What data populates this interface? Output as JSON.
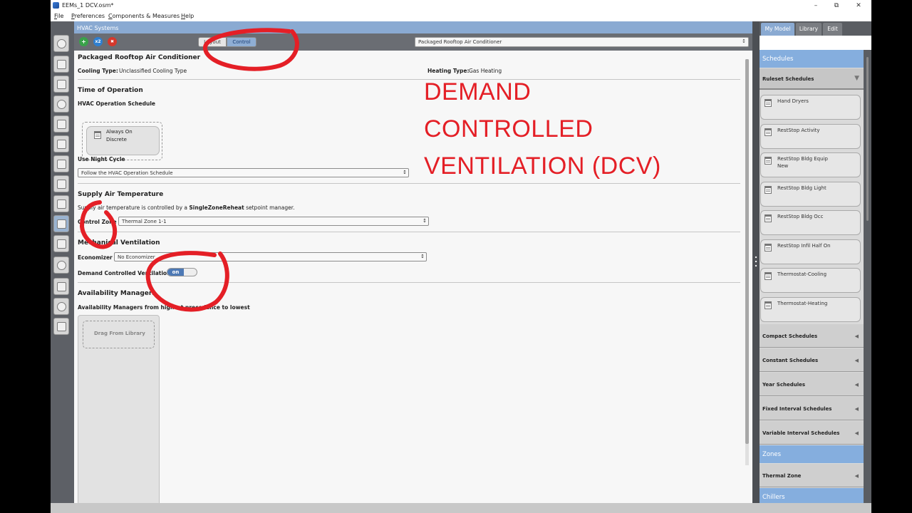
{
  "window": {
    "title": "EEMs_1 DCV.osm*",
    "minimize": "–",
    "maximize": "⧉",
    "close": "✕"
  },
  "menu": [
    "File",
    "Preferences",
    "Components & Measures",
    "Help"
  ],
  "left_nav": [
    "site-icon",
    "schedules-icon",
    "constructions-icon",
    "loads-icon",
    "space-types-icon",
    "geometry-icon",
    "facility-icon",
    "spaces-icon",
    "thermal-zones-icon",
    "hvac-systems-icon",
    "output-variables-icon",
    "simulation-settings-icon",
    "measures-icon",
    "run-icon",
    "results-icon"
  ],
  "hvac": {
    "header": "HVAC Systems",
    "toolbar": {
      "add": "+",
      "copy": "x2",
      "delete": "✖",
      "layout_tab": "Layout",
      "control_tab": "Control",
      "system_selected": "Packaged Rooftop Air Conditioner"
    },
    "system_title": "Packaged Rooftop Air Conditioner",
    "cooling_type_label": "Cooling Type:",
    "cooling_type_value": "Unclassified Cooling Type",
    "heating_type_label": "Heating Type:",
    "heating_type_value": "Gas Heating",
    "time_of_operation": {
      "title": "Time of Operation",
      "schedule_label": "HVAC Operation Schedule",
      "schedule_name_line1": "Always On",
      "schedule_name_line2": "Discrete",
      "night_cycle_label": "Use Night Cycle",
      "night_cycle_value": "Follow the HVAC Operation Schedule"
    },
    "supply_air": {
      "title": "Supply Air Temperature",
      "desc_prefix": "Supply air temperature is controlled by a",
      "desc_bold": "SingleZoneReheat",
      "desc_suffix": "setpoint manager.",
      "control_zone_label": "Control Zone",
      "control_zone_value": "Thermal Zone 1-1"
    },
    "mech_vent": {
      "title": "Mechanical Ventilation",
      "economizer_label": "Economizer",
      "economizer_value": "No Economizer",
      "dcv_label": "Demand Controlled Ventilation",
      "dcv_state": "on"
    },
    "availability": {
      "title": "Availability Managers",
      "desc": "Availability Managers from highest precedence to lowest",
      "drop_label": "Drag From Library"
    }
  },
  "overlay": {
    "line1": "DEMAND",
    "line2": "CONTROLLED",
    "line3": "VENTILATION (DCV)",
    "color": "#e41f26"
  },
  "right_panel": {
    "tabs": [
      "My Model",
      "Library",
      "Edit"
    ],
    "schedules_header": "Schedules",
    "ruleset_header": "Ruleset Schedules",
    "ruleset_items": [
      {
        "line1": "Hand Dryers",
        "line2": ""
      },
      {
        "line1": "RestStop Activity",
        "line2": ""
      },
      {
        "line1": "RestStop Bldg Equip",
        "line2": "New"
      },
      {
        "line1": "RestStop Bldg Light",
        "line2": ""
      },
      {
        "line1": "RestStop Bldg Occ",
        "line2": ""
      },
      {
        "line1": "RestStop Infil Half On",
        "line2": ""
      },
      {
        "line1": "Thermostat-Cooling",
        "line2": ""
      },
      {
        "line1": "Thermostat-Heating",
        "line2": ""
      }
    ],
    "other_schedule_types": [
      "Compact Schedules",
      "Constant Schedules",
      "Year Schedules",
      "Fixed Interval Schedules",
      "Variable Interval Schedules"
    ],
    "zones_header": "Zones",
    "thermal_zone": "Thermal Zone",
    "chillers_header": "Chillers"
  }
}
